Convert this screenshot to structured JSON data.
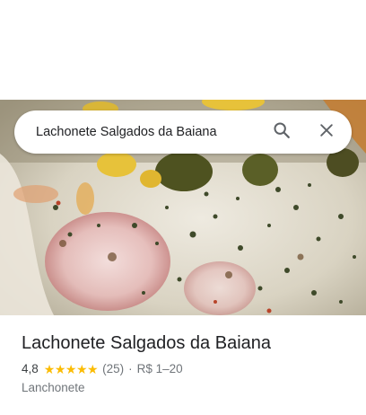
{
  "search": {
    "query": "Lachonete Salgados da Baiana",
    "search_icon": "search-icon",
    "close_icon": "close-icon"
  },
  "hero_photo": {
    "subject": "pizza-photo"
  },
  "place": {
    "name": "Lachonete Salgados da Baiana",
    "rating": "4,8",
    "stars_filled": 5,
    "review_count": "(25)",
    "separator": "·",
    "price_range": "R$ 1–20",
    "category": "Lanchonete"
  },
  "colors": {
    "star": "#fbbc04",
    "title_text": "#202124",
    "secondary_text": "#70757a"
  }
}
